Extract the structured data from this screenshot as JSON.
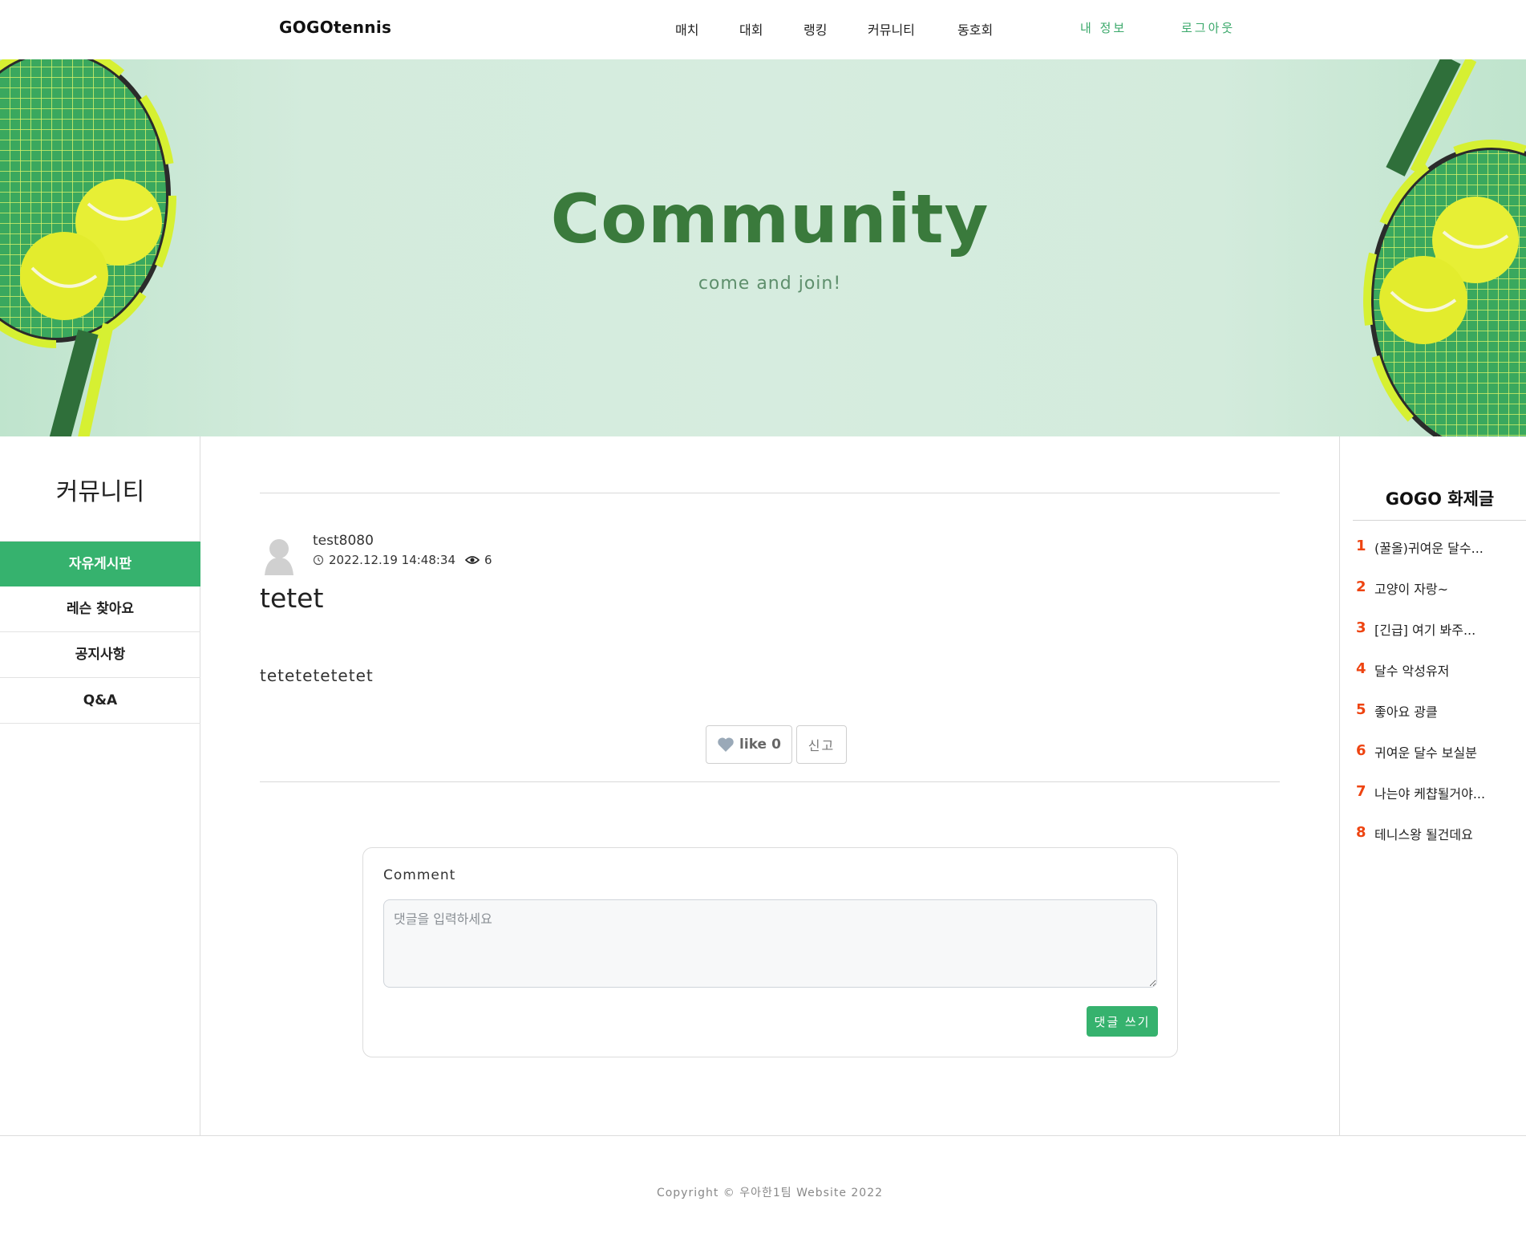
{
  "header": {
    "logo": "GOGOtennis",
    "nav": [
      "매치",
      "대회",
      "랭킹",
      "커뮤니티",
      "동호회"
    ],
    "my_info": "내 정보",
    "logout": "로그아웃"
  },
  "hero": {
    "title": "Community",
    "subtitle": "come and join!"
  },
  "sidebar": {
    "title": "커뮤니티",
    "items": [
      {
        "label": "자유게시판",
        "active": true
      },
      {
        "label": "레슨 찾아요",
        "active": false
      },
      {
        "label": "공지사항",
        "active": false
      },
      {
        "label": "Q&A",
        "active": false
      }
    ]
  },
  "post": {
    "author": "test8080",
    "datetime": "2022.12.19 14:48:34",
    "views": "6",
    "title": "tetet",
    "content": "tetetetetetet",
    "like_label": "like",
    "like_count": "0",
    "report_label": "신고"
  },
  "comment": {
    "label": "Comment",
    "placeholder": "댓글을 입력하세요",
    "submit_label": "댓글 쓰기"
  },
  "hot_posts": {
    "title": "GOGO 화제글",
    "items": [
      {
        "rank": "1",
        "title": "(꿀올)귀여운 달수..."
      },
      {
        "rank": "2",
        "title": "고양이 자랑~"
      },
      {
        "rank": "3",
        "title": "[긴급] 여기 봐주..."
      },
      {
        "rank": "4",
        "title": "달수 악성유저"
      },
      {
        "rank": "5",
        "title": "좋아요 광클"
      },
      {
        "rank": "6",
        "title": "귀여운 달수 보실분"
      },
      {
        "rank": "7",
        "title": "나는야 케챱될거야..."
      },
      {
        "rank": "8",
        "title": "테니스왕 될건데요"
      }
    ]
  },
  "footer": {
    "copyright": "Copyright © 우아한1팀 Website 2022"
  },
  "colors": {
    "accent": "#36b26e",
    "hero_title": "#3a7a3c",
    "hot_rank": "#ee4411"
  }
}
